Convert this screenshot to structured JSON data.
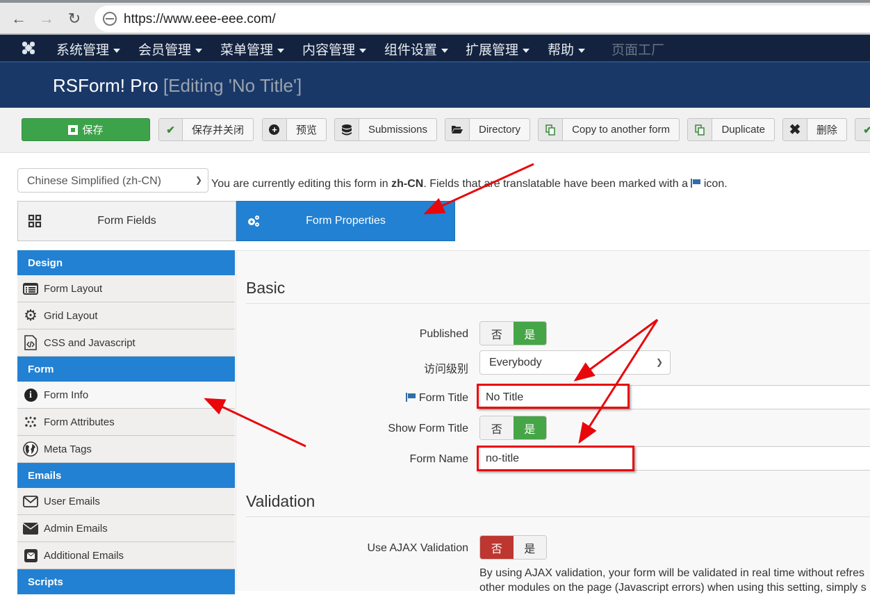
{
  "browser": {
    "url": "https://www.eee-eee.com/",
    "back_icon": "arrow-left",
    "forward_icon": "arrow-right",
    "reload_icon": "reload"
  },
  "topmenu": {
    "items": [
      {
        "label": "系统管理",
        "dropdown": true
      },
      {
        "label": "会员管理",
        "dropdown": true
      },
      {
        "label": "菜单管理",
        "dropdown": true
      },
      {
        "label": "内容管理",
        "dropdown": true
      },
      {
        "label": "组件设置",
        "dropdown": true
      },
      {
        "label": "扩展管理",
        "dropdown": true
      },
      {
        "label": "帮助",
        "dropdown": true
      },
      {
        "label": "页面工厂",
        "dropdown": false,
        "disabled": true
      }
    ]
  },
  "header": {
    "title": "RSForm! Pro",
    "subtitle": "[Editing 'No Title']"
  },
  "toolbar": {
    "buttons": [
      {
        "label": "保存",
        "icon": "edit-icon"
      },
      {
        "label": "保存并关闭",
        "icon": "check-icon"
      },
      {
        "label": "预览",
        "icon": "plus-circle-icon"
      },
      {
        "label": "Submissions",
        "icon": "database-icon"
      },
      {
        "label": "Directory",
        "icon": "folder-open-icon"
      },
      {
        "label": "Copy to another form",
        "icon": "copy-icon"
      },
      {
        "label": "Duplicate",
        "icon": "copy-icon"
      },
      {
        "label": "删除",
        "icon": "x-icon"
      },
      {
        "label": "",
        "icon": "check-icon"
      }
    ]
  },
  "language": {
    "selected": "Chinese Simplified (zh-CN)",
    "note_prefix": "You are currently editing this form in ",
    "note_lang": "zh-CN",
    "note_middle": ". Fields that are translatable have been marked with a ",
    "note_suffix": " icon."
  },
  "tabs": [
    {
      "label": "Form Fields",
      "active": false
    },
    {
      "label": "Form Properties",
      "active": true
    }
  ],
  "sidebar": {
    "sections": [
      {
        "title": "Design",
        "items": [
          {
            "label": "Form Layout",
            "icon": "list-alt-icon"
          },
          {
            "label": "Grid Layout",
            "icon": "gear-icon"
          },
          {
            "label": "CSS and Javascript",
            "icon": "code-file-icon"
          }
        ]
      },
      {
        "title": "Form",
        "items": [
          {
            "label": "Form Info",
            "icon": "info-circle-icon",
            "active": true
          },
          {
            "label": "Form Attributes",
            "icon": "dots-icon"
          },
          {
            "label": "Meta Tags",
            "icon": "globe-icon"
          }
        ]
      },
      {
        "title": "Emails",
        "items": [
          {
            "label": "User Emails",
            "icon": "envelope-outline-icon"
          },
          {
            "label": "Admin Emails",
            "icon": "envelope-icon"
          },
          {
            "label": "Additional Emails",
            "icon": "envelope-square-icon"
          }
        ]
      },
      {
        "title": "Scripts",
        "items": []
      }
    ]
  },
  "main": {
    "basic": {
      "title": "Basic",
      "published": {
        "label": "Published",
        "no": "否",
        "yes": "是",
        "value": "yes"
      },
      "access": {
        "label": "访问级别",
        "value": "Everybody"
      },
      "form_title": {
        "label": "Form Title",
        "value": "No Title",
        "translatable": true
      },
      "show_form_title": {
        "label": "Show Form Title",
        "no": "否",
        "yes": "是",
        "value": "yes"
      },
      "form_name": {
        "label": "Form Name",
        "value": "no-title"
      }
    },
    "validation": {
      "title": "Validation",
      "ajax": {
        "label": "Use AJAX Validation",
        "no": "否",
        "yes": "是",
        "value": "no"
      },
      "help_line1": "By using AJAX validation, your form will be validated in real time without refres",
      "help_line2": "other modules on the page (Javascript errors) when using this setting, simply s"
    }
  },
  "annotation_color": "#e8070b"
}
